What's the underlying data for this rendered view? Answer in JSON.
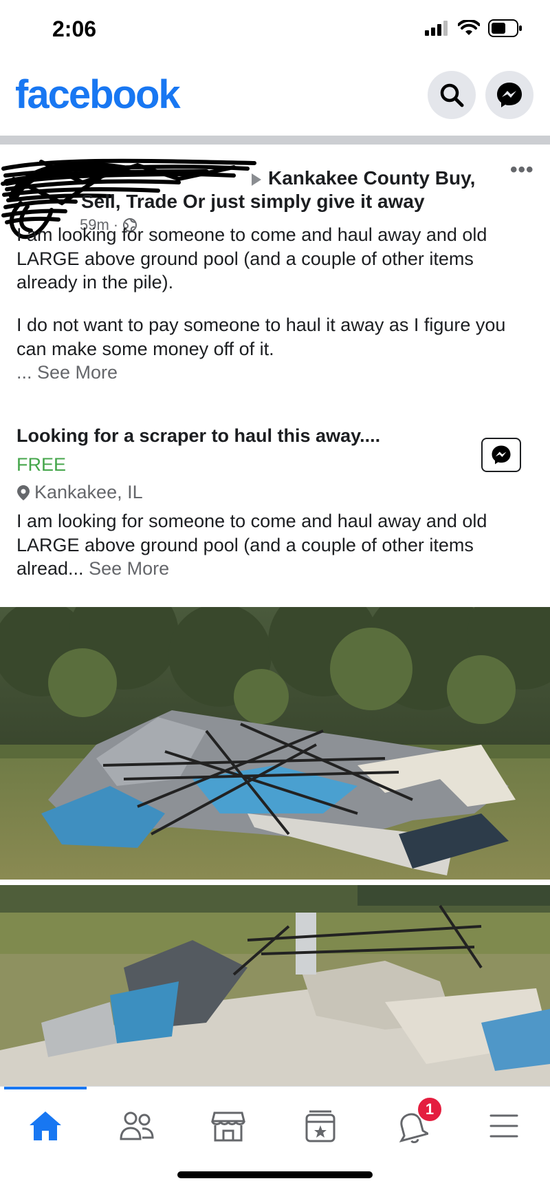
{
  "status_bar": {
    "time": "2:06"
  },
  "header": {
    "logo": "facebook",
    "search_icon": "search-icon",
    "messenger_icon": "messenger-icon"
  },
  "post": {
    "author_redacted": true,
    "group_name": "Kankakee County Buy, Sell, Trade Or just simply give it away",
    "time_ago": "59m",
    "audience_icon": "globe-icon",
    "more_label": "•••",
    "body_line1": "I am looking for someone to come and haul away and old LARGE above ground pool (and a couple of other items already in the pile).",
    "body_line2": "I do not want to pay someone to haul it away as I figure you can make some money off of it.",
    "see_more_1": "... See More",
    "listing": {
      "title": "Looking for a scraper to haul this away....",
      "price": "FREE",
      "location": "Kankakee, IL",
      "description": "I am looking for someone to come and haul away and old LARGE above ground pool (and a couple of other items alread...",
      "see_more": "See More"
    }
  },
  "tabbar": {
    "items": [
      "home-icon",
      "friends-icon",
      "marketplace-icon",
      "watch-icon",
      "notifications-icon",
      "menu-icon"
    ],
    "notifications_badge": "1",
    "accent_color": "#1877f2"
  }
}
